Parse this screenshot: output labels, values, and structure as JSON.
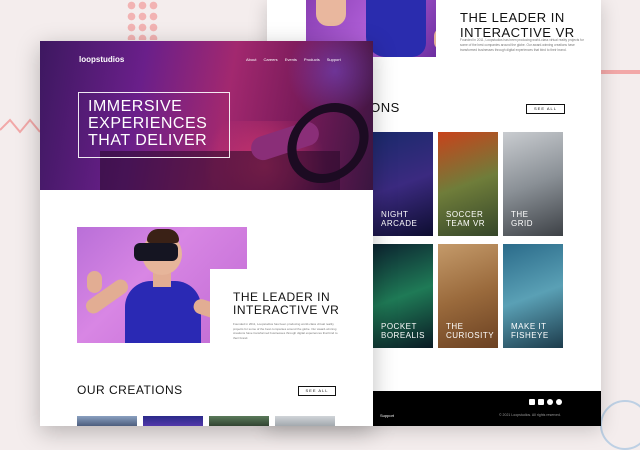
{
  "front": {
    "brand": "loopstudios",
    "nav": [
      "About",
      "Careers",
      "Events",
      "Products",
      "Support"
    ],
    "hero_title": [
      "IMMERSIVE",
      "EXPERIENCES",
      "THAT DELIVER"
    ],
    "leader_title": [
      "THE LEADER IN",
      "INTERACTIVE VR"
    ],
    "leader_text": "Founded in 2011, Loopstudios has been producing world-class virtual reality projects for some of the best companies around the globe. Our award-winning creations have transformed businesses through digital experiences that bind to their brand.",
    "creations_title": "OUR CREATIONS",
    "see_all": "SEE ALL"
  },
  "back": {
    "leader_title": [
      "THE LEADER IN",
      "INTERACTIVE VR"
    ],
    "leader_text": "Founded in 2011, Loopstudios has been producing world-class virtual reality projects for some of the best companies around the globe. Our award-winning creations have transformed businesses through digital experiences that bind to their brand.",
    "creations_title": "IONS",
    "see_all": "SEE ALL",
    "cards": [
      {
        "label": [
          "NIGHT",
          "ARCADE"
        ],
        "colors": [
          "#1a2a6c",
          "#3b2a80",
          "#0d0d30"
        ]
      },
      {
        "label": [
          "SOCCER",
          "TEAM VR"
        ],
        "colors": [
          "#c8421b",
          "#6f7d3a",
          "#35462a"
        ]
      },
      {
        "label": [
          "THE",
          "GRID"
        ],
        "colors": [
          "#c9ccd0",
          "#8a9096",
          "#3d4146"
        ]
      },
      {
        "label": [
          "POCKET",
          "BOREALIS"
        ],
        "colors": [
          "#0c2330",
          "#1f7a56",
          "#0a1a24"
        ]
      },
      {
        "label": [
          "THE",
          "CURIOSITY"
        ],
        "colors": [
          "#c49a6a",
          "#9a6a3c",
          "#6b4122"
        ]
      },
      {
        "label": [
          "MAKE IT",
          "FISHEYE"
        ],
        "colors": [
          "#2b6b8a",
          "#5aa0b5",
          "#1d3c4c"
        ]
      }
    ],
    "footer_support": "Support",
    "footer_copy": "© 2021 Loopstudios. All rights reserved.",
    "social_icons": [
      "facebook-icon",
      "twitter-icon",
      "pinterest-icon",
      "instagram-icon"
    ]
  }
}
